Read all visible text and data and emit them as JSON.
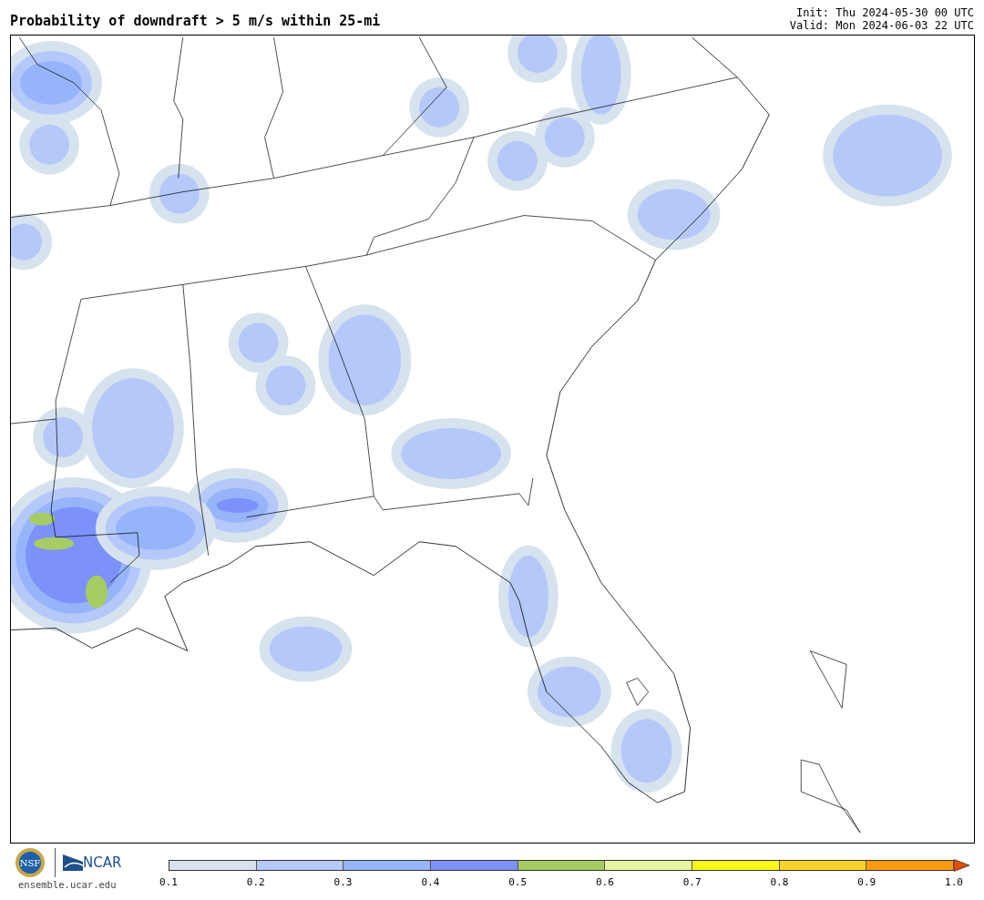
{
  "title": "Probability of downdraft > 5 m/s within 25-mi",
  "init": "Init: Thu 2024-05-30 00 UTC",
  "valid": "Valid: Mon 2024-06-03 22 UTC",
  "logos": {
    "nsf": "NSF",
    "ncar": "NCAR",
    "site": "ensemble.ucar.edu"
  },
  "colorbar": {
    "bins": [
      {
        "color": "#d6e2ee"
      },
      {
        "color": "#b4c8fa"
      },
      {
        "color": "#96b4fa"
      },
      {
        "color": "#7d91fa"
      },
      {
        "color": "#a5cd64"
      },
      {
        "color": "#e6f5a0"
      },
      {
        "color": "#fafa14"
      },
      {
        "color": "#fad22d"
      },
      {
        "color": "#fa9b0a"
      }
    ],
    "extend": {
      "color": "#e64b00"
    },
    "ticks": [
      "0.1",
      "0.2",
      "0.3",
      "0.4",
      "0.5",
      "0.6",
      "0.7",
      "0.8",
      "0.9",
      "1.0"
    ]
  }
}
